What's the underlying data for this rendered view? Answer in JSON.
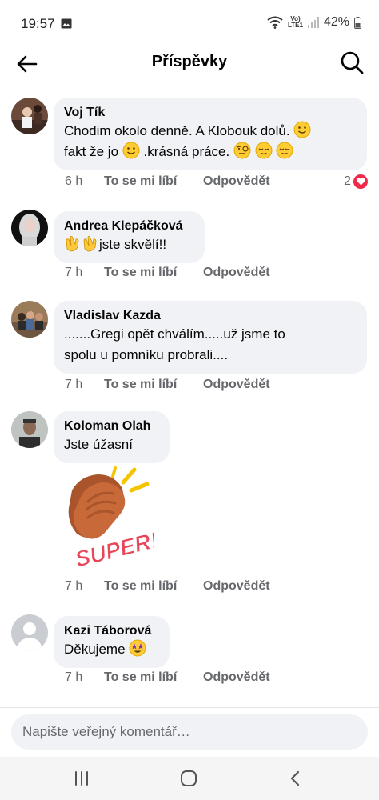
{
  "status_bar": {
    "time": "19:57",
    "battery": "42%",
    "volte_line1": "Vo)",
    "volte_line2": "LTE1"
  },
  "header": {
    "title": "Příspěvky"
  },
  "actions": {
    "like_label": "To se mi líbí",
    "reply_label": "Odpovědět"
  },
  "comments": [
    {
      "author": "Voj Tík",
      "text_line1": "Chodim okolo denně. A Klobouk dolů.",
      "text_line2a": "fakt že jo",
      "text_line2b": ".krásná práce.",
      "time": "6 h",
      "reaction_count": "2"
    },
    {
      "author": "Andrea Klepáčková",
      "text": "jste skvělí!!",
      "time": "7 h"
    },
    {
      "author": "Vladislav Kazda",
      "text_line1": ".......Gregi opět  chválím.....už jsme to",
      "text_line2": "spolu u pomníku probrali....",
      "time": "7 h"
    },
    {
      "author": "Koloman Olah",
      "text": "Jste úžasní",
      "time": "7 h",
      "sticker_text": "SUPER!"
    },
    {
      "author": "Kazi Táborová",
      "text": "Děkujeme",
      "time": "7 h"
    }
  ],
  "composer": {
    "placeholder": "Napište veřejný komentář…"
  },
  "icons": [
    "back-arrow-icon",
    "search-icon",
    "gallery-icon",
    "wifi-icon",
    "signal-icon",
    "battery-icon",
    "heart-icon",
    "recents-icon",
    "home-icon",
    "back-nav-icon"
  ],
  "colors": {
    "bubble": "#f0f2f5",
    "meta": "#65676b",
    "heart": "#f02849",
    "sticker_red": "#e8475a",
    "hand": "#c8693a",
    "sparkle": "#f5c400"
  }
}
